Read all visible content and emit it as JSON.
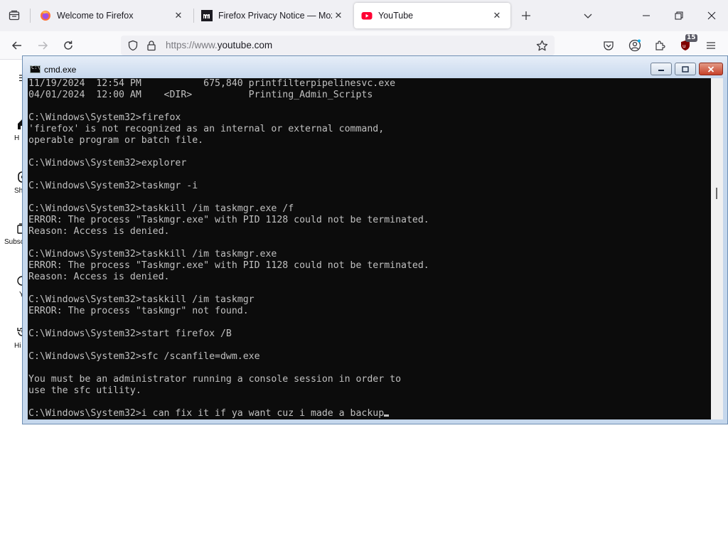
{
  "tabs": [
    {
      "title": "Welcome to Firefox",
      "favicon": "firefox-icon",
      "active": false
    },
    {
      "title": "Firefox Privacy Notice — Mozill",
      "favicon": "mozilla-icon",
      "active": false
    },
    {
      "title": "YouTube",
      "favicon": "youtube-icon",
      "active": true
    }
  ],
  "navbar": {
    "url_prefix": "https://www.",
    "url_domain": "youtube.com",
    "extension_badge": "15"
  },
  "youtube_guide": {
    "items": [
      {
        "label": "H",
        "icon": "home-icon"
      },
      {
        "label": "Sh",
        "icon": "shorts-icon"
      },
      {
        "label": "Subsc",
        "icon": "subscriptions-icon"
      },
      {
        "label": "Y",
        "icon": "you-icon"
      },
      {
        "label": "Hi",
        "icon": "history-icon"
      }
    ]
  },
  "cmd_window": {
    "title": "cmd.exe",
    "lines": [
      "11/19/2024  12:54 PM           675,840 printfilterpipelinesvc.exe",
      "04/01/2024  12:00 AM    <DIR>          Printing_Admin_Scripts",
      "",
      "C:\\Windows\\System32>firefox",
      "'firefox' is not recognized as an internal or external command,",
      "operable program or batch file.",
      "",
      "C:\\Windows\\System32>explorer",
      "",
      "C:\\Windows\\System32>taskmgr -i",
      "",
      "C:\\Windows\\System32>taskkill /im taskmgr.exe /f",
      "ERROR: The process \"Taskmgr.exe\" with PID 1128 could not be terminated.",
      "Reason: Access is denied.",
      "",
      "C:\\Windows\\System32>taskkill /im taskmgr.exe",
      "ERROR: The process \"Taskmgr.exe\" with PID 1128 could not be terminated.",
      "Reason: Access is denied.",
      "",
      "C:\\Windows\\System32>taskkill /im taskmgr",
      "ERROR: The process \"taskmgr\" not found.",
      "",
      "C:\\Windows\\System32>start firefox /B",
      "",
      "C:\\Windows\\System32>sfc /scanfile=dwm.exe",
      "",
      "You must be an administrator running a console session in order to",
      "use the sfc utility.",
      ""
    ],
    "current_input": "C:\\Windows\\System32>i can fix it if ya want cuz i made a backup"
  },
  "colors": {
    "console_bg": "#0c0c0c",
    "console_fg": "#c0c0c0",
    "youtube_red": "#ff0033",
    "tabstrip_bg": "#f0f0f4"
  }
}
